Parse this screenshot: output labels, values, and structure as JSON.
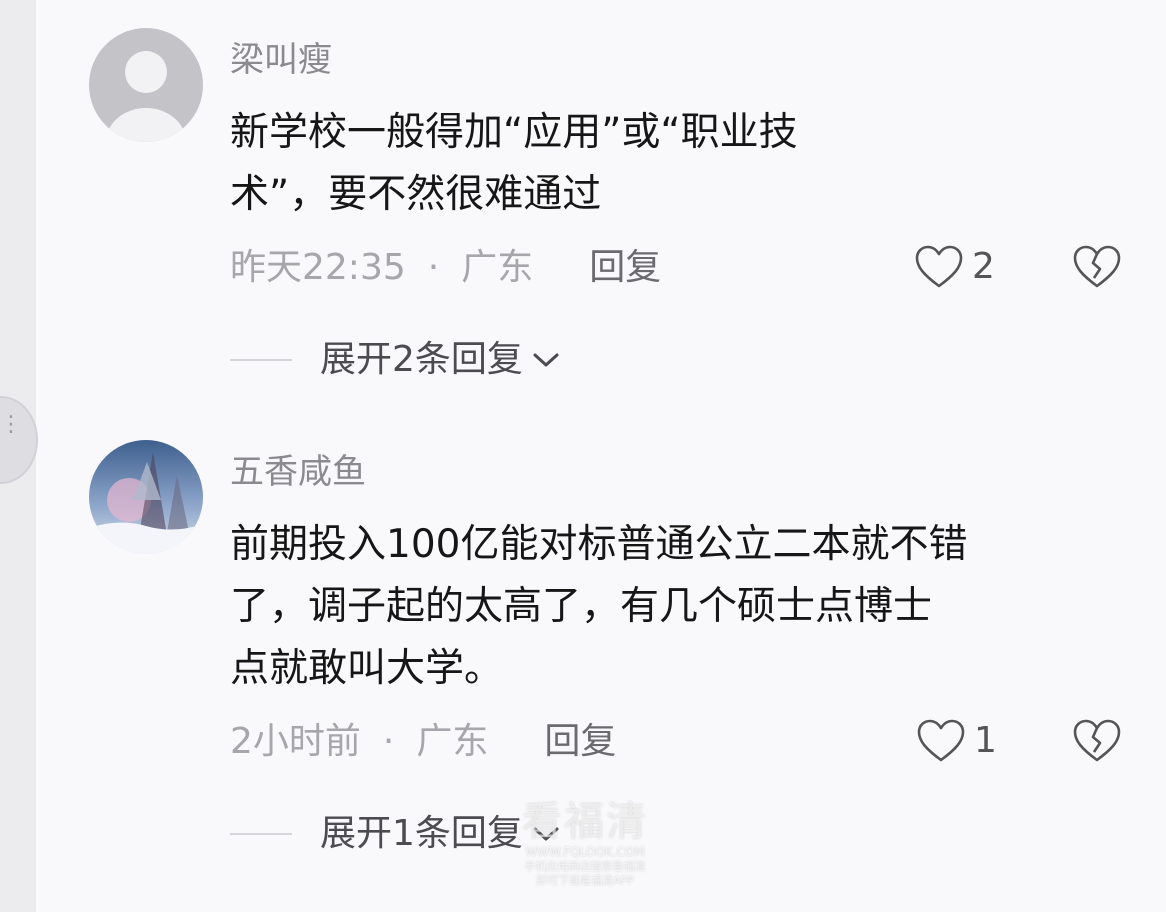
{
  "comments": [
    {
      "username": "梁叫瘦",
      "content_lines": [
        "新学校一般得加“应用”或“职业技",
        "术”，要不然很难通过"
      ],
      "time": "昨天22:35",
      "separator": "·",
      "location": "广东",
      "reply_label": "回复",
      "likes": "2",
      "expand_label": "展开2条回复"
    },
    {
      "username": "五香咸鱼",
      "content_lines": [
        "前期投入100亿能对标普通公立二本就不错",
        "了，调子起的太高了，有几个硕士点博士",
        "点就敢叫大学。"
      ],
      "time": "2小时前",
      "separator": "·",
      "location": "广东",
      "reply_label": "回复",
      "likes": "1",
      "expand_label": "展开1条回复"
    }
  ],
  "watermark": {
    "title": "看福清",
    "url": "WWW.FQLOOK.COM",
    "line1": "手机应用商店搜索看福清",
    "line2": "即可下载看福清APP"
  },
  "icons": {
    "like": "heart-outline-icon",
    "dislike": "broken-heart-icon",
    "expand": "chevron-down-icon"
  }
}
